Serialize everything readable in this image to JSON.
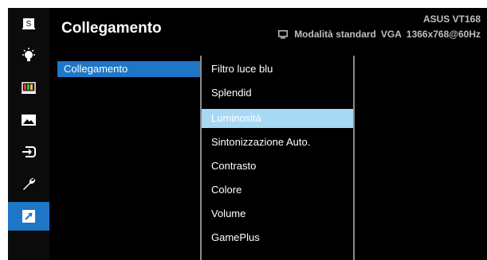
{
  "header": {
    "title": "Collegamento",
    "model": "ASUS VT168",
    "mode": "Modalità standard",
    "input": "VGA",
    "resolution": "1366x768@60Hz"
  },
  "sidebar": {
    "items": [
      {
        "icon": "splendid-s-icon"
      },
      {
        "icon": "blue-light-bulb-icon"
      },
      {
        "icon": "color-bars-icon"
      },
      {
        "icon": "image-icon"
      },
      {
        "icon": "input-select-icon"
      },
      {
        "icon": "wrench-icon"
      },
      {
        "icon": "shortcut-arrow-icon",
        "active": true
      }
    ]
  },
  "submenu": {
    "items": [
      "Collegamento"
    ],
    "selected": "Collegamento"
  },
  "options": {
    "items": [
      "Filtro luce blu",
      "Splendid",
      "Luminosità",
      "Sintonizzazione Auto.",
      "Contrasto",
      "Colore",
      "Volume",
      "GamePlus"
    ],
    "selected_index": 2
  },
  "colors": {
    "accent": "#1e76c6",
    "highlight": "#a7d8f4",
    "background": "#000000"
  }
}
